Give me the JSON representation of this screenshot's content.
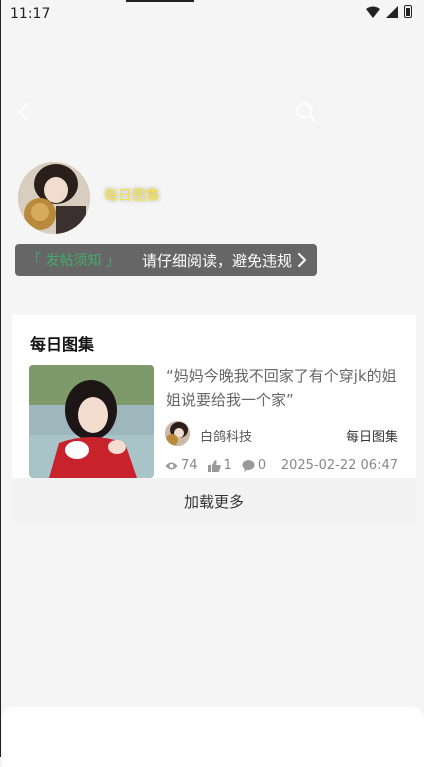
{
  "status": {
    "time": "11:17"
  },
  "profile": {
    "name": "每日图集"
  },
  "notice": {
    "tag": "「 发帖须知 」",
    "text": "请仔细阅读，避免违规"
  },
  "card": {
    "title": "每日图集",
    "post": {
      "title": "“妈妈今晚我不回家了有个穿jk的姐姐说要给我一个家”",
      "author": "白鸽科技",
      "category": "每日图集",
      "views": "74",
      "likes": "1",
      "comments": "0",
      "date": "2025-02-22 06:47"
    }
  },
  "load_more": "加载更多",
  "colors": {
    "username": "#f4e23a",
    "notice_bg": "#666666",
    "notice_tag": "#36c86b"
  },
  "icons": [
    "back-icon",
    "search-icon",
    "views-icon",
    "likes-icon",
    "comments-icon",
    "chevron-right-icon",
    "wifi-icon",
    "signal-icon",
    "battery-icon"
  ]
}
